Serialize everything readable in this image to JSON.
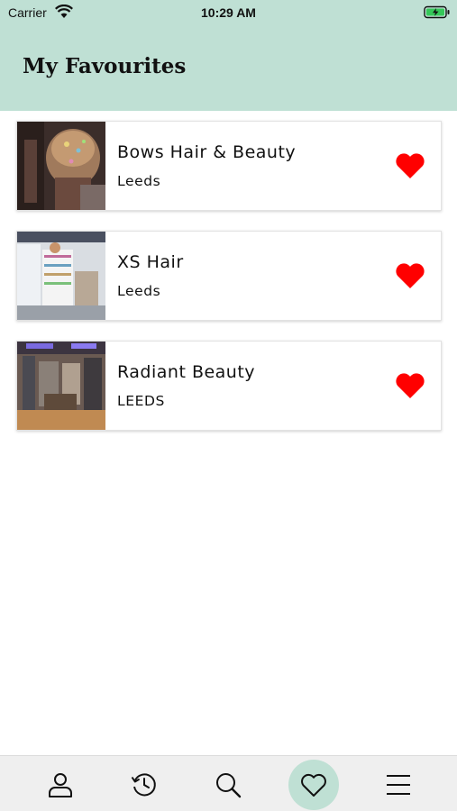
{
  "status_bar": {
    "carrier": "Carrier",
    "time": "10:29 AM"
  },
  "header": {
    "title": "My Favourites"
  },
  "favourites": [
    {
      "name": "Bows Hair & Beauty",
      "city": "Leeds",
      "favourited": true
    },
    {
      "name": "XS Hair",
      "city": "Leeds",
      "favourited": true
    },
    {
      "name": "Radiant Beauty",
      "city": "LEEDS",
      "favourited": true
    }
  ],
  "tabbar": {
    "tabs": [
      {
        "icon": "user-icon",
        "active": false
      },
      {
        "icon": "history-icon",
        "active": false
      },
      {
        "icon": "search-icon",
        "active": false
      },
      {
        "icon": "heart-outline-icon",
        "active": true
      },
      {
        "icon": "menu-icon",
        "active": false
      }
    ]
  },
  "colors": {
    "header_bg": "#bfe0d4",
    "heart": "#ff0000",
    "active_tab_bg": "#bfe0d4",
    "tabbar_bg": "#efefef"
  }
}
